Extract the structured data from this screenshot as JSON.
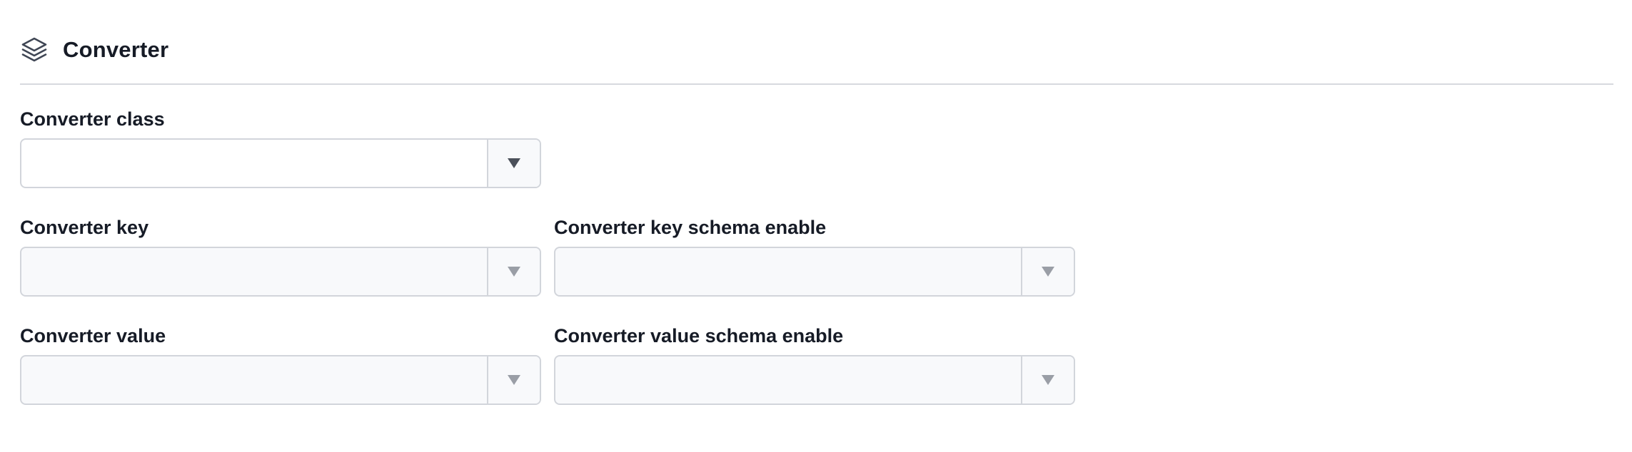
{
  "section": {
    "title": "Converter",
    "icon": "layers-icon"
  },
  "fields": {
    "converter_class": {
      "label": "Converter class",
      "value": "",
      "disabled": false
    },
    "converter_key": {
      "label": "Converter key",
      "value": "",
      "disabled": true
    },
    "converter_key_schema_enable": {
      "label": "Converter key schema enable",
      "value": "",
      "disabled": true
    },
    "converter_value": {
      "label": "Converter value",
      "value": "",
      "disabled": true
    },
    "converter_value_schema_enable": {
      "label": "Converter value schema enable",
      "value": "",
      "disabled": true
    }
  },
  "colors": {
    "text": "#161b26",
    "border": "#d2d5db",
    "disabled_bg": "#f8f9fb",
    "caret_enabled": "#4b505a",
    "caret_disabled": "#9a9ea6"
  }
}
